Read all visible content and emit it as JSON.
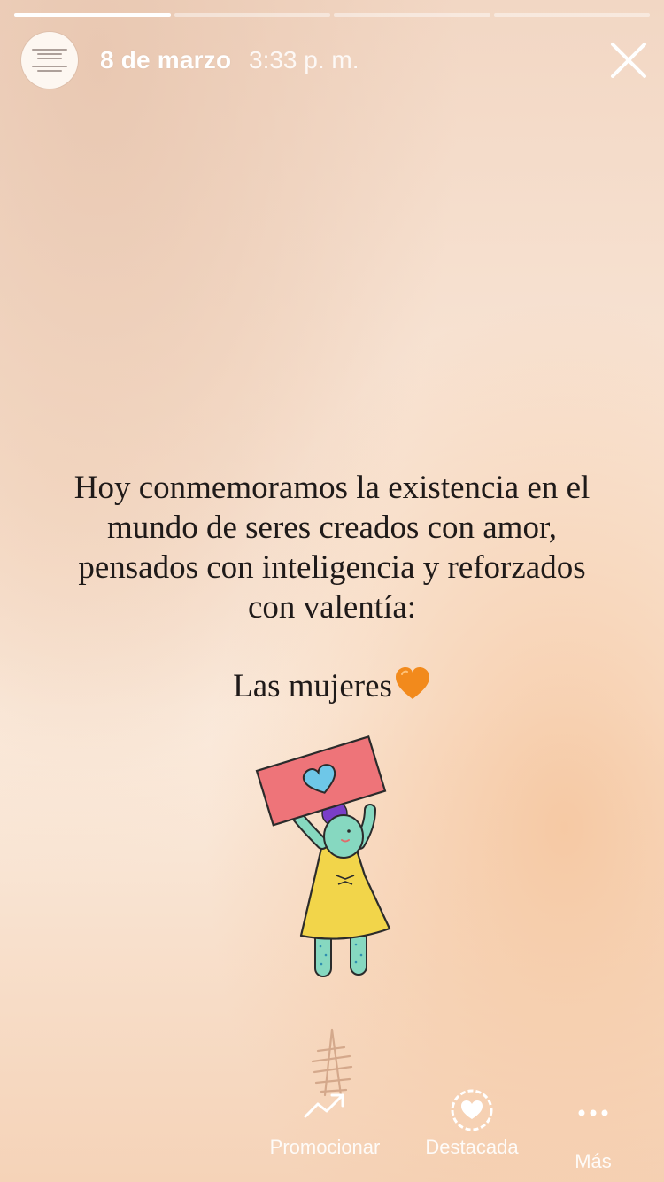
{
  "story": {
    "progress": [
      {
        "fraction": 1.0
      },
      {
        "fraction": 0.0
      },
      {
        "fraction": 0.0
      },
      {
        "fraction": 0.0
      }
    ],
    "header": {
      "date": "8 de marzo",
      "time": "3:33 p. m."
    },
    "message": {
      "lines": [
        "Hoy conmemoramos la existencia en el",
        "mundo de seres creados con amor,",
        "pensados con inteligencia y reforzados",
        "con valentía:"
      ],
      "closing": "Las mujeres"
    },
    "icons": {
      "close": "close-icon",
      "heart_emoji": "orange-heart-icon",
      "promote": "trend-arrow-icon",
      "highlight": "heart-circle-icon",
      "more": "more-dots-icon"
    },
    "colors": {
      "heart": "#f28a1c",
      "sign": "#ee7479",
      "dress": "#f2d54a",
      "skin": "#86d8c0",
      "hair": "#7a3ec8"
    }
  },
  "actions": [
    {
      "label": "Promocionar"
    },
    {
      "label": "Destacada"
    },
    {
      "label": "Más"
    }
  ]
}
